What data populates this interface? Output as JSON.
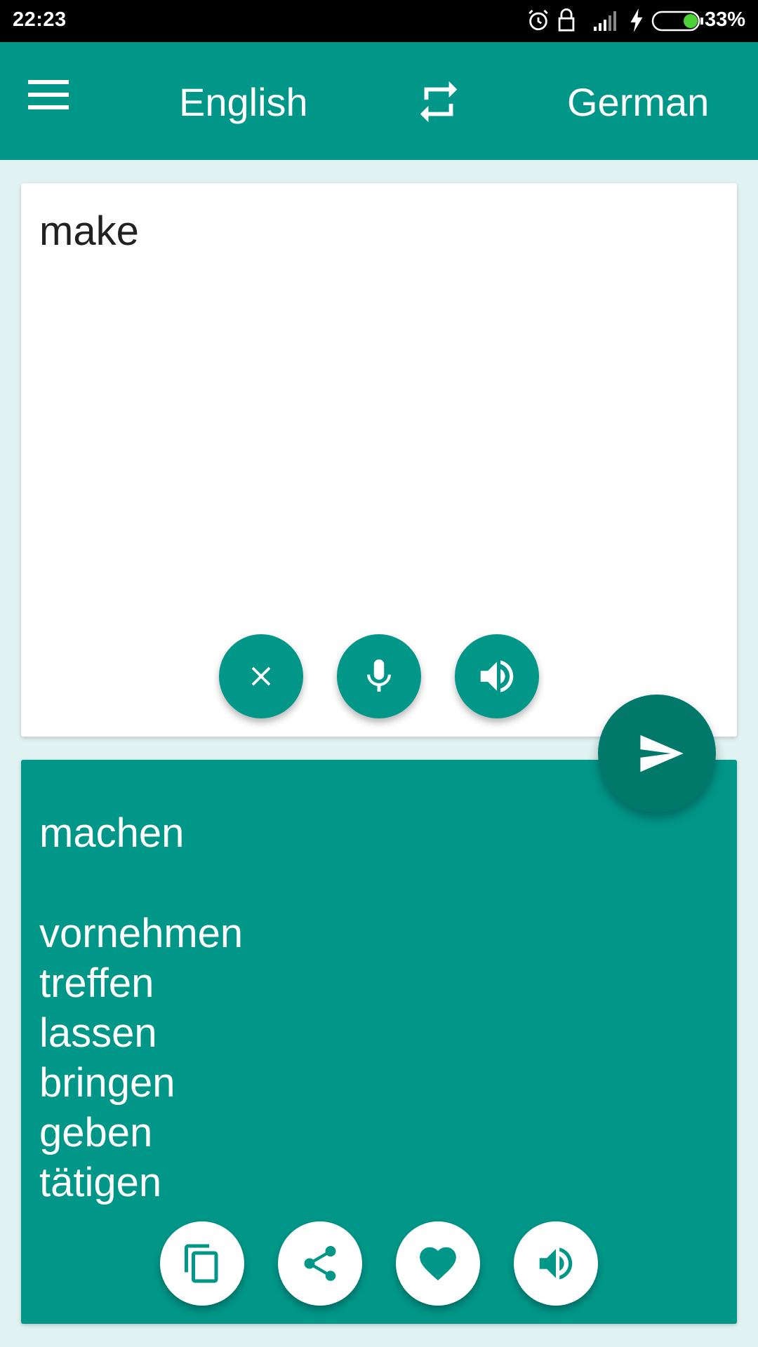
{
  "status_bar": {
    "time": "22:23",
    "battery_percent": "33%",
    "battery_level": 0.33,
    "icons": [
      "alarm-icon",
      "lock-icon",
      "signal-icon",
      "charging-icon",
      "battery-icon"
    ]
  },
  "toolbar": {
    "source_language": "English",
    "target_language": "German",
    "menu_icon": "menu-icon",
    "swap_icon": "swap-icon"
  },
  "input": {
    "text": "make",
    "actions": [
      "clear-icon",
      "mic-icon",
      "speaker-icon"
    ]
  },
  "translate_button": {
    "icon": "send-icon"
  },
  "output": {
    "main_translation": "machen",
    "alternatives": [
      "vornehmen",
      "treffen",
      "lassen",
      "bringen",
      "geben",
      "tätigen"
    ],
    "actions": [
      "copy-icon",
      "share-icon",
      "favorite-icon",
      "speaker-icon"
    ]
  },
  "colors": {
    "primary": "#009688",
    "primary_dark": "#00796B",
    "background": "#E0F2F1",
    "battery_fill": "#4CD137"
  }
}
